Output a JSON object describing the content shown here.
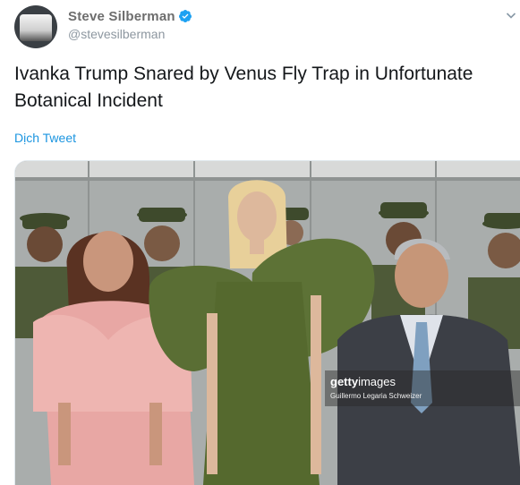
{
  "tweet": {
    "display_name": "Steve Silberman",
    "handle": "@stevesilberman",
    "verified": true,
    "text": "Ivanka Trump Snared by Venus Fly Trap in Unfortunate Botanical Incident",
    "translate_label": "Dịch Tweet"
  },
  "photo": {
    "watermark_brand_bold": "getty",
    "watermark_brand_thin": "images",
    "watermark_credit": "Guillermo Legaria Schweizer"
  },
  "icons": {
    "verified": "verified-badge-icon",
    "menu": "chevron-down-icon"
  },
  "colors": {
    "link": "#1b95e0",
    "verified": "#1da1f2",
    "text": "#14171a",
    "muted": "#8d97a0"
  }
}
